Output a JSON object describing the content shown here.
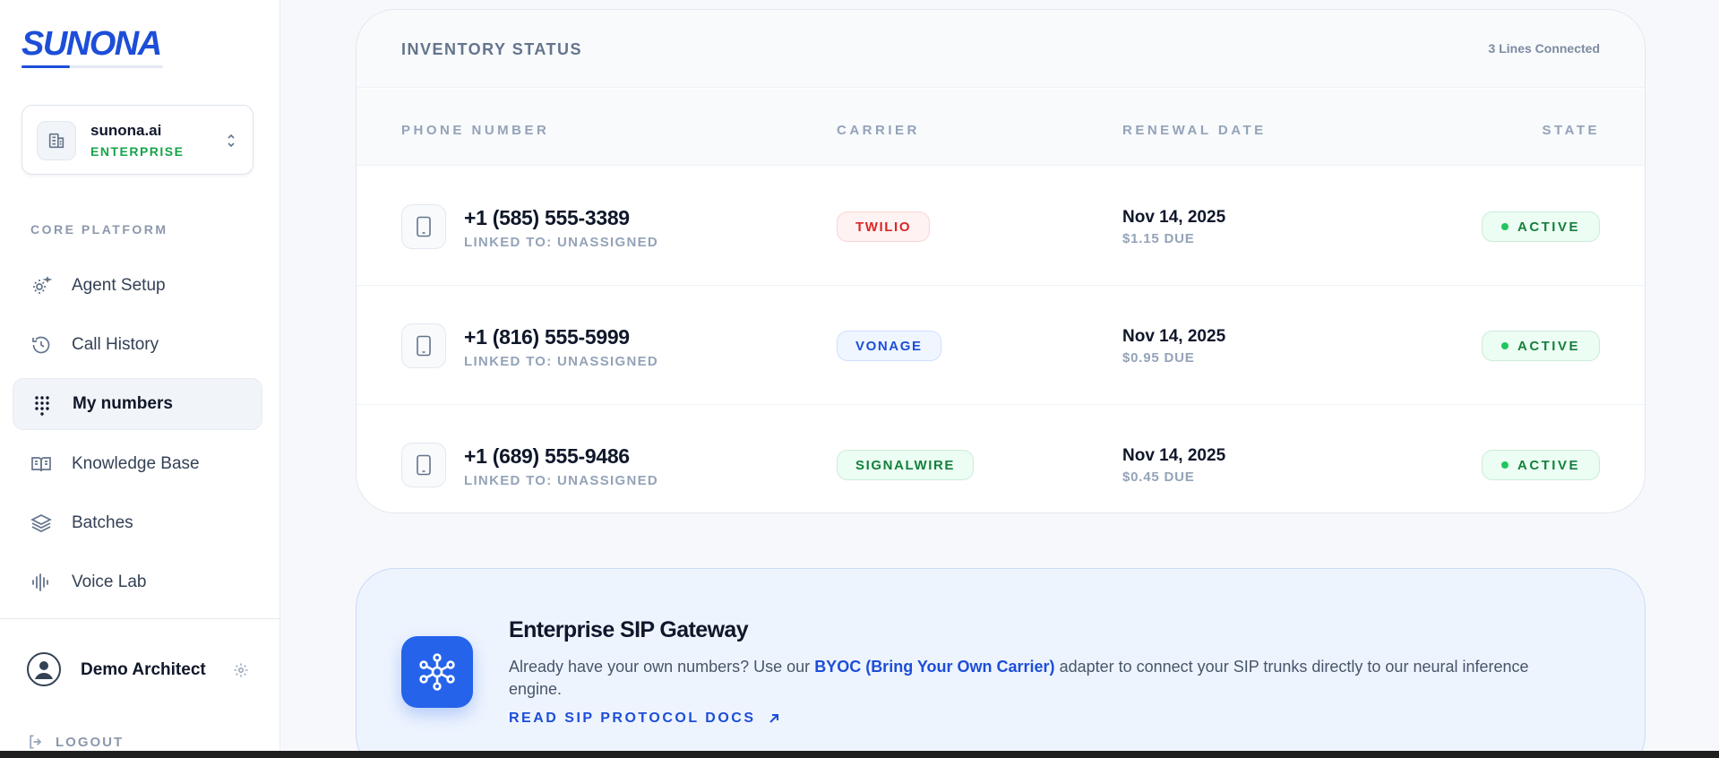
{
  "brand": {
    "logo_text": "SUNONA",
    "accent": "#1d4ed8"
  },
  "org": {
    "name": "sunona.ai",
    "plan": "ENTERPRISE"
  },
  "sidebar": {
    "section_label": "CORE PLATFORM",
    "items": [
      {
        "label": "Agent Setup",
        "icon": "gear-sparkle-icon"
      },
      {
        "label": "Call History",
        "icon": "history-icon"
      },
      {
        "label": "My numbers",
        "icon": "dialpad-icon",
        "active": true
      },
      {
        "label": "Knowledge Base",
        "icon": "book-icon"
      },
      {
        "label": "Batches",
        "icon": "layers-icon"
      },
      {
        "label": "Voice Lab",
        "icon": "waveform-icon"
      }
    ],
    "user_name": "Demo Architect",
    "logout_label": "LOGOUT"
  },
  "inventory": {
    "title": "INVENTORY STATUS",
    "count": "3 Lines Connected",
    "columns": [
      "PHONE NUMBER",
      "CARRIER",
      "RENEWAL DATE",
      "STATE"
    ],
    "rows": [
      {
        "number": "+1 (585) 555-3389",
        "linked": "LINKED TO: UNASSIGNED",
        "carrier": "TWILIO",
        "carrier_color": "#dc2626",
        "renewal_date": "Nov 14, 2025",
        "due": "$1.15 DUE",
        "state": "ACTIVE"
      },
      {
        "number": "+1 (816) 555-5999",
        "linked": "LINKED TO: UNASSIGNED",
        "carrier": "VONAGE",
        "carrier_color": "#1d4ed8",
        "renewal_date": "Nov 14, 2025",
        "due": "$0.95 DUE",
        "state": "ACTIVE"
      },
      {
        "number": "+1 (689) 555-9486",
        "linked": "LINKED TO: UNASSIGNED",
        "carrier": "SIGNALWIRE",
        "carrier_color": "#15803d",
        "renewal_date": "Nov 14, 2025",
        "due": "$0.45 DUE",
        "state": "ACTIVE"
      }
    ]
  },
  "sip": {
    "title": "Enterprise SIP Gateway",
    "desc_before": "Already have your own numbers? Use our ",
    "desc_highlight": "BYOC (Bring Your Own Carrier)",
    "desc_after": " adapter to connect your SIP trunks directly to our neural inference engine.",
    "link_label": "READ SIP PROTOCOL DOCS"
  }
}
